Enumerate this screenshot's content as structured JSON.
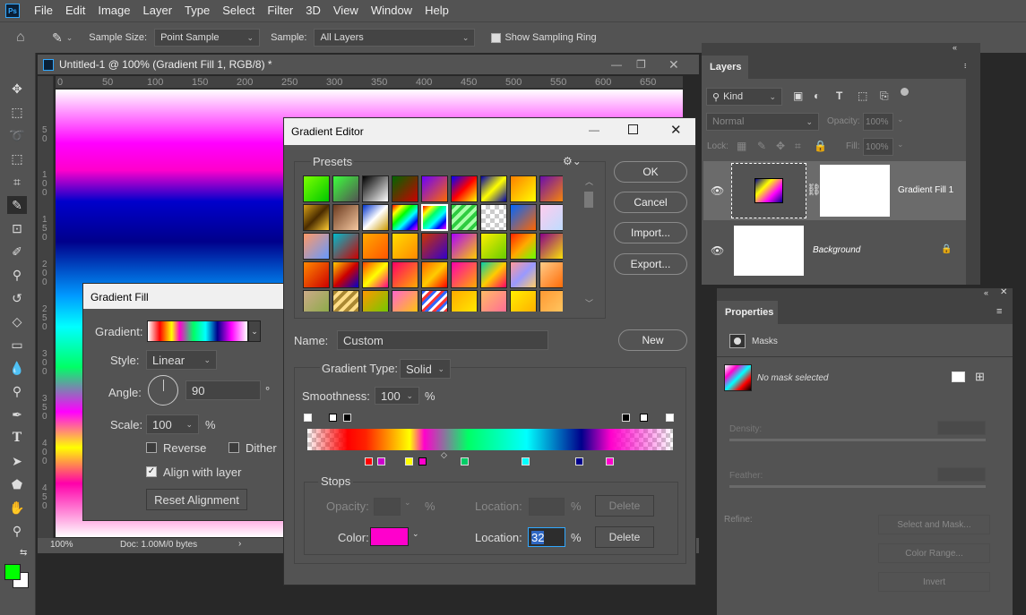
{
  "menubar": {
    "logo": "Ps",
    "items": [
      "File",
      "Edit",
      "Image",
      "Layer",
      "Type",
      "Select",
      "Filter",
      "3D",
      "View",
      "Window",
      "Help"
    ]
  },
  "options": {
    "sample_size_label": "Sample Size:",
    "sample_size_value": "Point Sample",
    "sample_label": "Sample:",
    "sample_value": "All Layers",
    "show_ring_label": "Show Sampling Ring"
  },
  "document": {
    "tab_title": "Untitled-1 @ 100% (Gradient Fill 1, RGB/8) *",
    "ruler_ticks": [
      "0",
      "50",
      "100",
      "150",
      "200",
      "250",
      "300",
      "350",
      "400",
      "450",
      "500",
      "550",
      "600",
      "650"
    ],
    "vruler_ticks": [
      "5\n0",
      "1\n0\n0",
      "1\n5\n0",
      "2\n0\n0",
      "2\n5\n0",
      "3\n0\n0",
      "3\n5\n0",
      "4\n0\n0",
      "4\n5\n0"
    ],
    "zoom": "100%",
    "doc_info": "Doc: 1.00M/0 bytes"
  },
  "gradient_fill": {
    "title": "Gradient Fill",
    "gradient_label": "Gradient:",
    "style_label": "Style:",
    "style_value": "Linear",
    "angle_label": "Angle:",
    "angle_value": "90",
    "angle_unit": "°",
    "scale_label": "Scale:",
    "scale_value": "100",
    "scale_unit": "%",
    "reverse_label": "Reverse",
    "dither_label": "Dither",
    "align_label": "Align with layer",
    "reset_label": "Reset Alignment"
  },
  "gradient_editor": {
    "title": "Gradient Editor",
    "presets_label": "Presets",
    "ok": "OK",
    "cancel": "Cancel",
    "import": "Import...",
    "export": "Export...",
    "name_label": "Name:",
    "name_value": "Custom",
    "new": "New",
    "type_label": "Gradient Type:",
    "type_value": "Solid",
    "smoothness_label": "Smoothness:",
    "smoothness_value": "100",
    "smoothness_unit": "%",
    "stops_label": "Stops",
    "opacity_label": "Opacity:",
    "opacity_unit": "%",
    "location_label": "Location:",
    "location_unit": "%",
    "delete": "Delete",
    "color_label": "Color:",
    "color_value": "#ff00cc",
    "location_value": "32",
    "delete2": "Delete"
  },
  "layers": {
    "tab": "Layers",
    "kind": "Kind",
    "blend": "Normal",
    "opacity_label": "Opacity:",
    "opacity_value": "100%",
    "lock_label": "Lock:",
    "fill_label": "Fill:",
    "fill_value": "100%",
    "items": [
      {
        "name": "Gradient Fill 1"
      },
      {
        "name": "Background"
      }
    ]
  },
  "properties": {
    "tab": "Properties",
    "masks": "Masks",
    "no_mask": "No mask selected",
    "density": "Density:",
    "feather": "Feather:",
    "refine": "Refine:",
    "select_mask": "Select and Mask...",
    "color_range": "Color Range...",
    "invert": "Invert"
  },
  "colors": {
    "accent": "#31a8ff",
    "foreground": "#00ff00",
    "background": "#ffffff"
  }
}
